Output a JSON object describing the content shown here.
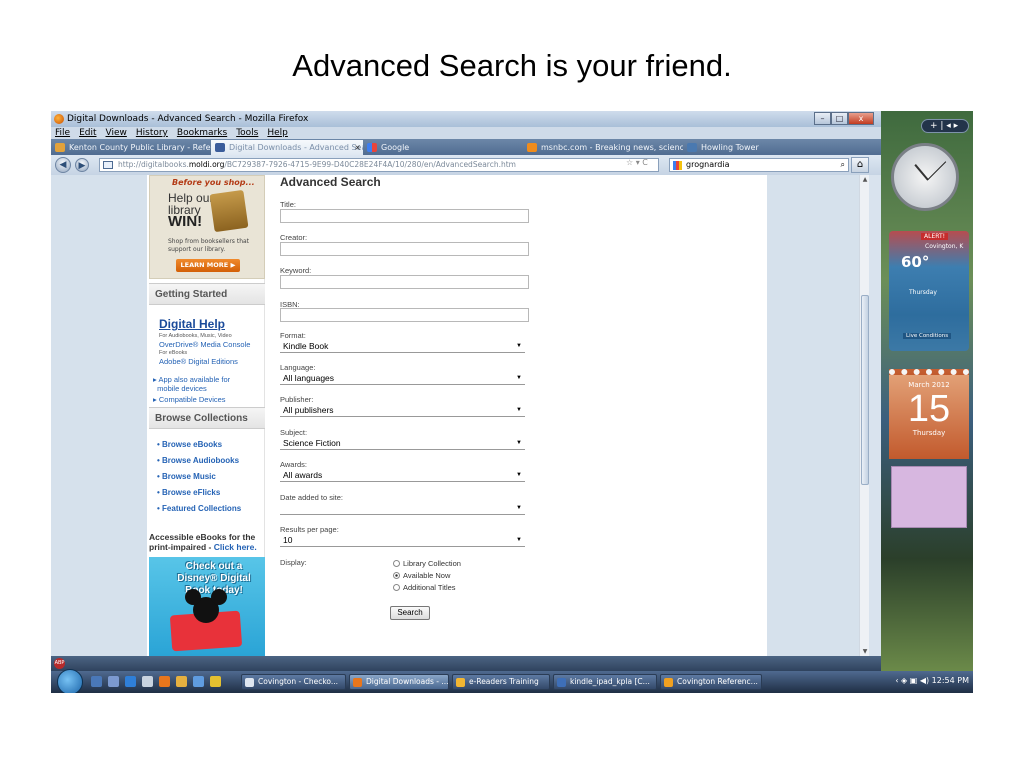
{
  "slide_title": "Advanced Search is your friend.",
  "window": {
    "title": "Digital Downloads - Advanced Search - Mozilla Firefox",
    "controls": [
      "–",
      "□",
      "x"
    ]
  },
  "menu": [
    "File",
    "Edit",
    "View",
    "History",
    "Bookmarks",
    "Tools",
    "Help"
  ],
  "tabs": [
    {
      "label": "Kenton County Public Library - Refe...",
      "active": false
    },
    {
      "label": "Digital Downloads - Advanced Search",
      "active": true
    },
    {
      "label": "Google",
      "active": false
    },
    {
      "label": "msnbc.com - Breaking news, scienc...",
      "active": false
    },
    {
      "label": "Howling Tower",
      "active": false
    }
  ],
  "tab_close": "×",
  "nav": {
    "back": "◀",
    "forward": "▶",
    "url_prefix": "http://digitalbooks.",
    "url_domain": "moldi.org",
    "url_rest": "/BC729387-7926-4715-9E99-D40C28E24F4A/10/280/en/AdvancedSearch.htm",
    "url_controls": "☆ ▾ C",
    "search_value": "grognardia",
    "search_icon": "⌕",
    "home_icon": "⌂"
  },
  "sidebar": {
    "promo_before": "Before you shop...",
    "promo_help_line1": "Help our",
    "promo_help_line2": "library",
    "promo_win": "WIN!",
    "promo_shop": "Shop from booksellers that support our library.",
    "promo_learn": "LEARN MORE ▶",
    "getting_started": "Getting Started",
    "digital_help": "Digital Help",
    "for_audio": "For Audiobooks, Music, Video",
    "overdrive": "OverDrive® Media Console",
    "for_ebooks": "For eBooks",
    "adobe": "Adobe® Digital Editions",
    "app_also_1": "App also available for",
    "app_also_2": "mobile devices",
    "compatible": "Compatible Devices",
    "browse_collections": "Browse Collections",
    "collections": [
      "Browse eBooks",
      "Browse Audiobooks",
      "Browse Music",
      "Browse eFlicks",
      "Featured Collections"
    ],
    "accessible_1": "Accessible eBooks for the",
    "accessible_2": "print-impaired - ",
    "accessible_link": "Click here.",
    "disney_text": "Check out a Disney® Digital Book today!"
  },
  "form": {
    "heading": "Advanced Search",
    "title_label": "Title:",
    "creator_label": "Creator:",
    "keyword_label": "Keyword:",
    "isbn_label": "ISBN:",
    "format_label": "Format:",
    "format_value": "Kindle Book",
    "language_label": "Language:",
    "language_value": "All languages",
    "publisher_label": "Publisher:",
    "publisher_value": "All publishers",
    "subject_label": "Subject:",
    "subject_value": "Science Fiction",
    "awards_label": "Awards:",
    "awards_value": "All awards",
    "date_label": "Date added to site:",
    "date_value": "",
    "results_label": "Results per page:",
    "results_value": "10",
    "display_label": "Display:",
    "display_options": [
      "Library Collection",
      "Available Now",
      "Additional Titles"
    ],
    "display_selected": "Available Now",
    "search_button": "Search"
  },
  "gadgets": {
    "buttons": "+ | ◂ ▸",
    "alert": "ALERT!",
    "city": "Covington, K",
    "temp": "60°",
    "day": "Thursday",
    "live": "Live Conditions",
    "cal_month": "March 2012",
    "cal_day": "15",
    "cal_dayname": "Thursday"
  },
  "statusbar": {
    "abp": "ABP"
  },
  "taskbar": {
    "items": [
      {
        "label": "Covington - Checko...",
        "active": false,
        "color": "#2c4a7c"
      },
      {
        "label": "Digital Downloads - ...",
        "active": true,
        "color": "#e8761c"
      },
      {
        "label": "e-Readers Training",
        "active": false,
        "color": "#f2b632"
      },
      {
        "label": "kindle_ipad_kpla [C...",
        "active": false,
        "color": "#3e6fb8"
      },
      {
        "label": "Covington Referenc...",
        "active": false,
        "color": "#f0a020"
      }
    ],
    "time": "12:54 PM",
    "tray_icons": "‹ ◈ ▣ ◀)"
  }
}
